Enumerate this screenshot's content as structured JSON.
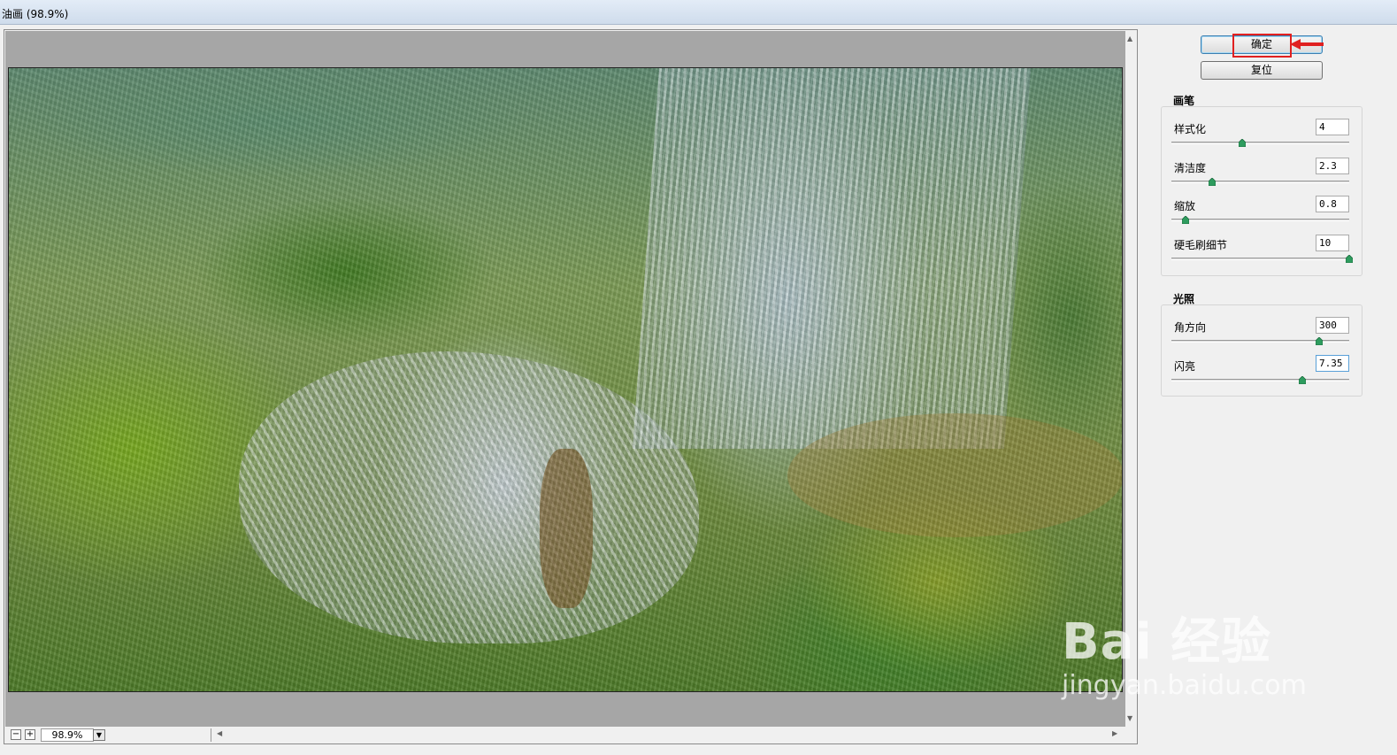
{
  "window": {
    "title": "油画 (98.9%)"
  },
  "preview": {
    "zoom_value": "98.9%",
    "zoom_out": "−",
    "zoom_in": "+"
  },
  "buttons": {
    "ok_label": "确定",
    "reset_label": "复位"
  },
  "brush": {
    "title": "画笔",
    "params": [
      {
        "label": "样式化",
        "value": "4",
        "slider_fraction": 0.4
      },
      {
        "label": "清洁度",
        "value": "2.3",
        "slider_fraction": 0.23
      },
      {
        "label": "缩放",
        "value": "0.8",
        "slider_fraction": 0.08
      },
      {
        "label": "硬毛刷细节",
        "value": "10",
        "slider_fraction": 1.0
      }
    ]
  },
  "lighting": {
    "title": "光照",
    "params": [
      {
        "label": "角方向",
        "value": "300",
        "slider_fraction": 0.83
      },
      {
        "label": "闪亮",
        "value": "7.35",
        "slider_fraction": 0.735
      }
    ]
  },
  "watermark": {
    "brand": "Bai 经验",
    "url": "jingyan.baidu.com"
  },
  "colors": {
    "highlight": "#e02020",
    "slider_thumb": "#2e9c5e"
  }
}
